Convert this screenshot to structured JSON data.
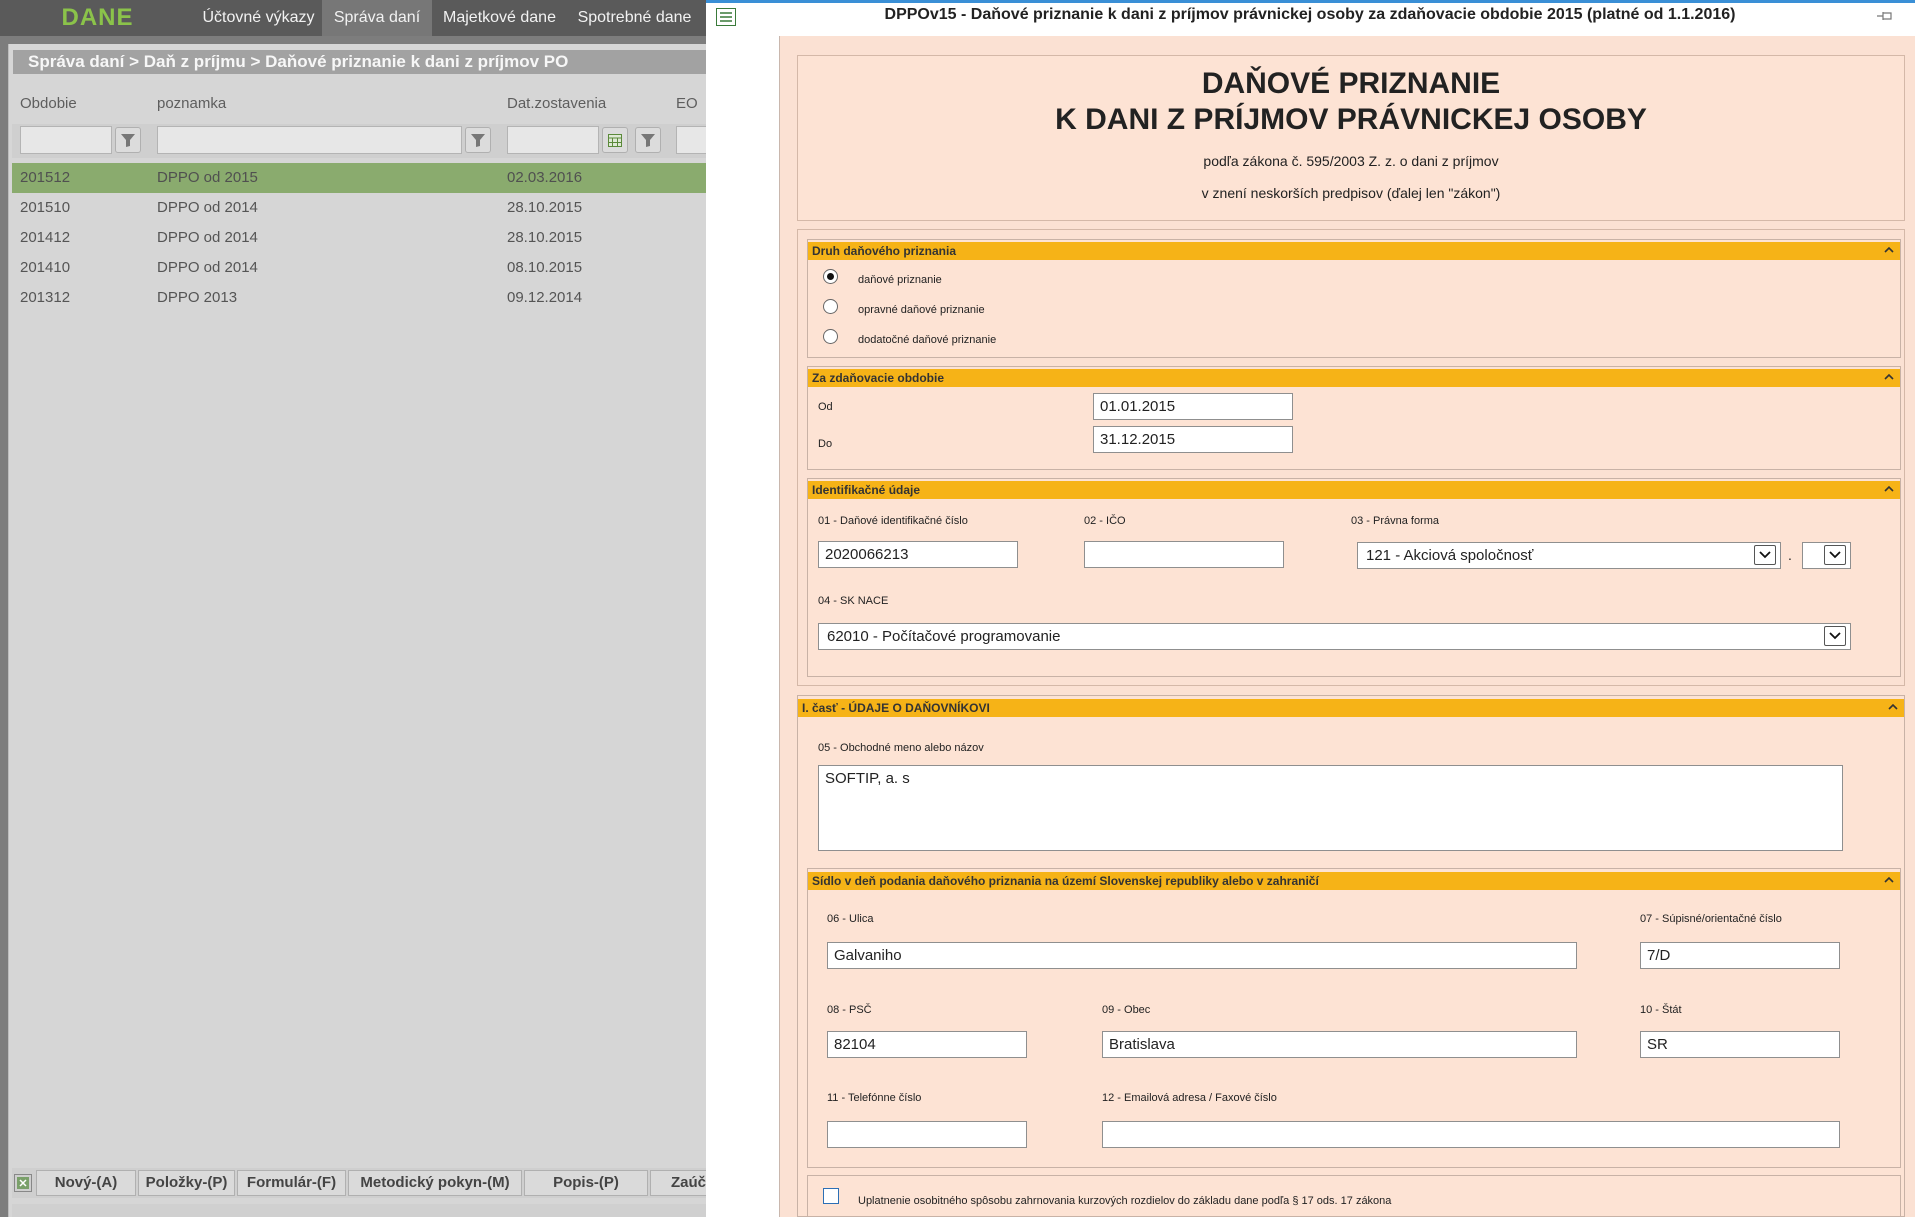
{
  "app": {
    "title": "DANE",
    "nav": [
      "Účtovné výkazy",
      "Správa daní",
      "Majetkové dane",
      "Spotrebné dane"
    ],
    "active_nav": "Správa daní",
    "breadcrumb": "Správa daní > Daň z príjmu > Daňové priznanie k dani z príjmov PO"
  },
  "table": {
    "columns": [
      "Obdobie",
      "poznamka",
      "Dat.zostavenia",
      "EO"
    ],
    "rows": [
      {
        "obdobie": "201512",
        "poznamka": "DPPO od 2015",
        "datum": "02.03.2016",
        "selected": true
      },
      {
        "obdobie": "201510",
        "poznamka": "DPPO od 2014",
        "datum": "28.10.2015"
      },
      {
        "obdobie": "201412",
        "poznamka": "DPPO od 2014",
        "datum": "28.10.2015"
      },
      {
        "obdobie": "201410",
        "poznamka": "DPPO od 2014",
        "datum": "08.10.2015"
      },
      {
        "obdobie": "201312",
        "poznamka": "DPPO 2013",
        "datum": "09.12.2014"
      }
    ]
  },
  "toolbar": {
    "buttons": [
      "Nový-(A)",
      "Položky-(P)",
      "Formulár-(F)",
      "Metodický pokyn-(M)",
      "Popis-(P)",
      "Zaúč"
    ]
  },
  "dialog": {
    "title": "DPPOv15 - Daňové priznanie k dani z príjmov právnickej osoby za zdaňovacie obdobie 2015 (platné od 1.1.2016)"
  },
  "form": {
    "heading_line1": "DAŇOVÉ PRIZNANIE",
    "heading_line2": "K DANI Z PRÍJMOV PRÁVNICKEJ OSOBY",
    "subtitle1": "podľa zákona č. 595/2003 Z. z. o dani z príjmov",
    "subtitle2": "v znení neskorších predpisov (ďalej len \"zákon\")",
    "druh": {
      "header": "Druh daňového priznania",
      "options": [
        "daňové priznanie",
        "opravné daňové priznanie",
        "dodatočné daňové priznanie"
      ],
      "selected": "daňové priznanie"
    },
    "obdobie": {
      "header": "Za zdaňovacie obdobie",
      "od_label": "Od",
      "od_value": "01.01.2015",
      "do_label": "Do",
      "do_value": "31.12.2015"
    },
    "identifikacne": {
      "header": "Identifikačné údaje",
      "dic_label": "01 - Daňové identifikačné číslo",
      "dic_value": "2020066213",
      "ico_label": "02 - IČO",
      "ico_value": "",
      "pravna_label": "03 - Právna forma",
      "pravna_value": "121 - Akciová spoločnosť",
      "pravna_sep": ".",
      "nace_label": "04 - SK NACE",
      "nace_value": "62010 - Počítačové programovanie"
    },
    "cast1": {
      "header": "I. časť - ÚDAJE O DAŇOVNÍKOVI",
      "meno_label": "05 - Obchodné meno alebo názov",
      "meno_value": "SOFTIP, a. s"
    },
    "sidlo": {
      "header": "Sídlo v deň podania daňového priznania na území Slovenskej republiky alebo v zahraničí",
      "ulica_label": "06 - Ulica",
      "ulica_value": "Galvaniho",
      "cislo_label": "07 - Súpisné/orientačné číslo",
      "cislo_value": "7/D",
      "psc_label": "08 - PSČ",
      "psc_value": "82104",
      "obec_label": "09 - Obec",
      "obec_value": "Bratislava",
      "stat_label": "10 - Štát",
      "stat_value": "SR",
      "tel_label": "11 - Telefónne číslo",
      "tel_value": "",
      "email_label": "12 - Emailová adresa / Faxové číslo",
      "email_value": ""
    },
    "kurzove_label": "Uplatnenie osobitného spôsobu zahrnovania kurzových rozdielov do základu dane podľa § 17 ods. 17 zákona"
  },
  "colors": {
    "section_header": "#f6b317",
    "form_bg": "#fbe1d3",
    "selected_row": "#8aab6e",
    "app_title": "#8bc34a"
  }
}
